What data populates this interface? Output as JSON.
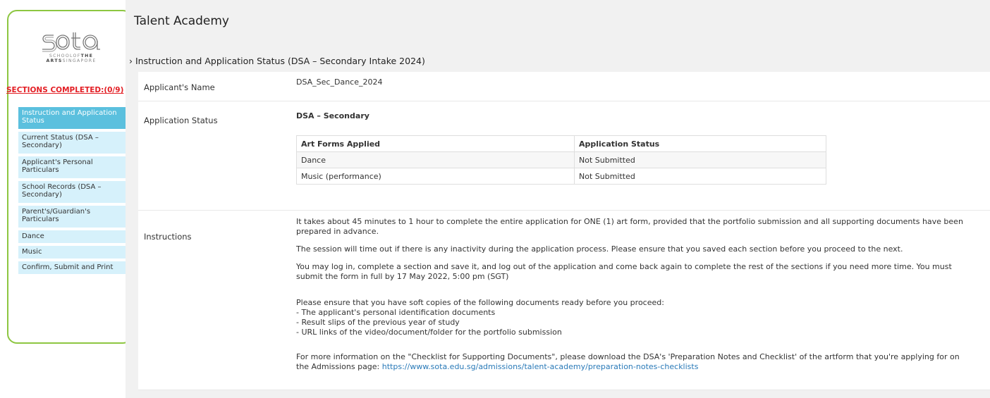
{
  "logo": {
    "wordmark": "sota",
    "sub_line1_pre": "SCHOOLOF",
    "sub_line1_bold": "THE",
    "sub_line2_bold": "ARTS",
    "sub_line2_post": "SINGAPORE"
  },
  "sidebar": {
    "sections_completed": "SECTIONS COMPLETED:(0/9)",
    "items": [
      {
        "label": "Instruction and Application Status"
      },
      {
        "label": "Current Status (DSA – Secondary)"
      },
      {
        "label": "Applicant's Personal Particulars"
      },
      {
        "label": "School Records (DSA – Secondary)"
      },
      {
        "label": "Parent's/Guardian's Particulars"
      },
      {
        "label": "Dance"
      },
      {
        "label": "Music"
      },
      {
        "label": "Confirm, Submit and Print"
      }
    ]
  },
  "header": {
    "title": "Talent Academy",
    "section_title": "› Instruction and Application Status (DSA – Secondary Intake 2024)"
  },
  "applicant": {
    "name_label": "Applicant's Name",
    "name_value": "DSA_Sec_Dance_2024"
  },
  "status": {
    "label": "Application Status",
    "heading": "DSA – Secondary",
    "col_art_forms": "Art Forms Applied",
    "col_status": "Application Status",
    "rows": [
      {
        "art_form": "Dance",
        "status": "Not Submitted"
      },
      {
        "art_form": "Music (performance)",
        "status": "Not Submitted"
      }
    ]
  },
  "instructions": {
    "label": "Instructions",
    "p1": "It takes about 45 minutes to 1 hour to complete the entire application for ONE (1) art form, provided that the portfolio submission and all supporting documents have been prepared in advance.",
    "p2": "The session will time out if there is any inactivity during the application process. Please ensure that you saved each section before you proceed to the next.",
    "p3": "You may log in, complete a section and save it, and log out of the application and come back again to complete the rest of the sections if you need more time. You must submit the form in full by 17 May 2022, 5:00 pm (SGT)",
    "p4_intro": "Please ensure that you have soft copies of the following documents ready before you proceed:",
    "p4_item1": "- The applicant's personal identification documents",
    "p4_item2": "- Result slips of the previous year of study",
    "p4_item3": "- URL links of the video/document/folder for the portfolio submission",
    "p5": "For more information on the \"Checklist for Supporting Documents\", please download the DSA's 'Preparation Notes and Checklist' of the artform that you're applying for on the Admissions page: ",
    "p5_link": "https://www.sota.edu.sg/admissions/talent-academy/preparation-notes-checklists"
  }
}
